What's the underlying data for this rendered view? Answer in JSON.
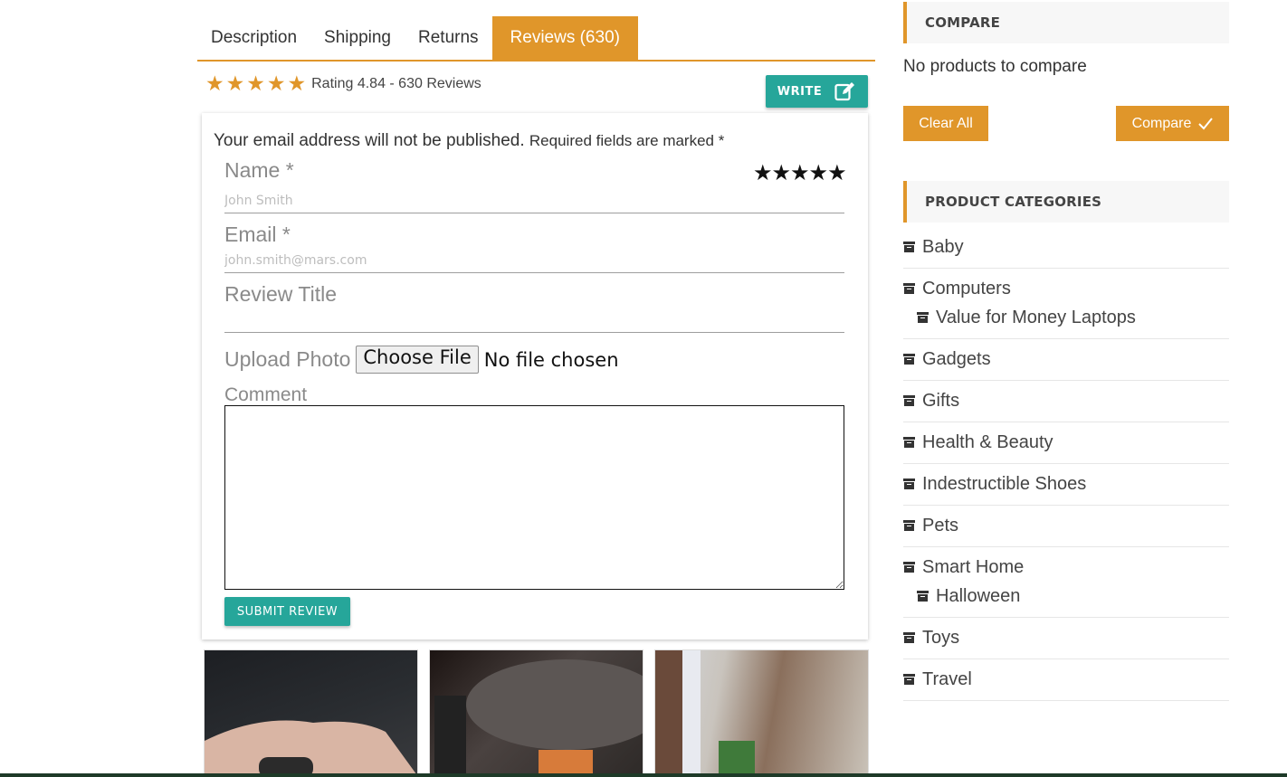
{
  "tabs": [
    {
      "label": "Description"
    },
    {
      "label": "Shipping"
    },
    {
      "label": "Returns"
    },
    {
      "label": "Reviews (630)"
    }
  ],
  "rating": {
    "text": "Rating 4.84 - 630 Reviews",
    "value": 4.84,
    "stars_filled": 5,
    "star_color": "#e0962a"
  },
  "write_button": {
    "label": "WRITE",
    "icon": "edit-icon"
  },
  "form": {
    "notice": "Your email address will not be published.",
    "notice_required": "Required fields are marked *",
    "name_label": "Name *",
    "name_placeholder": "John Smith",
    "email_label": "Email *",
    "email_placeholder": "john.smith@mars.com",
    "title_label": "Review Title",
    "upload_label": "Upload Photo",
    "choose_file": "Choose File",
    "no_file": "No file chosen",
    "comment_label": "Comment",
    "submit_label": "SUBMIT REVIEW",
    "star_rating": 5
  },
  "sidebar": {
    "compare_heading": "COMPARE",
    "no_products": "No products to compare",
    "clear_all": "Clear All",
    "compare_button": "Compare",
    "categories_heading": "PRODUCT CATEGORIES",
    "categories": [
      {
        "label": "Baby"
      },
      {
        "label": "Computers",
        "children": [
          "Value for Money Laptops"
        ]
      },
      {
        "label": "Gadgets"
      },
      {
        "label": "Gifts"
      },
      {
        "label": "Health & Beauty"
      },
      {
        "label": "Indestructible Shoes"
      },
      {
        "label": "Pets"
      },
      {
        "label": "Smart Home",
        "children": [
          "Halloween"
        ]
      },
      {
        "label": "Toys"
      },
      {
        "label": "Travel"
      }
    ]
  },
  "colors": {
    "accent": "#e0962a",
    "teal": "#26a69a"
  }
}
